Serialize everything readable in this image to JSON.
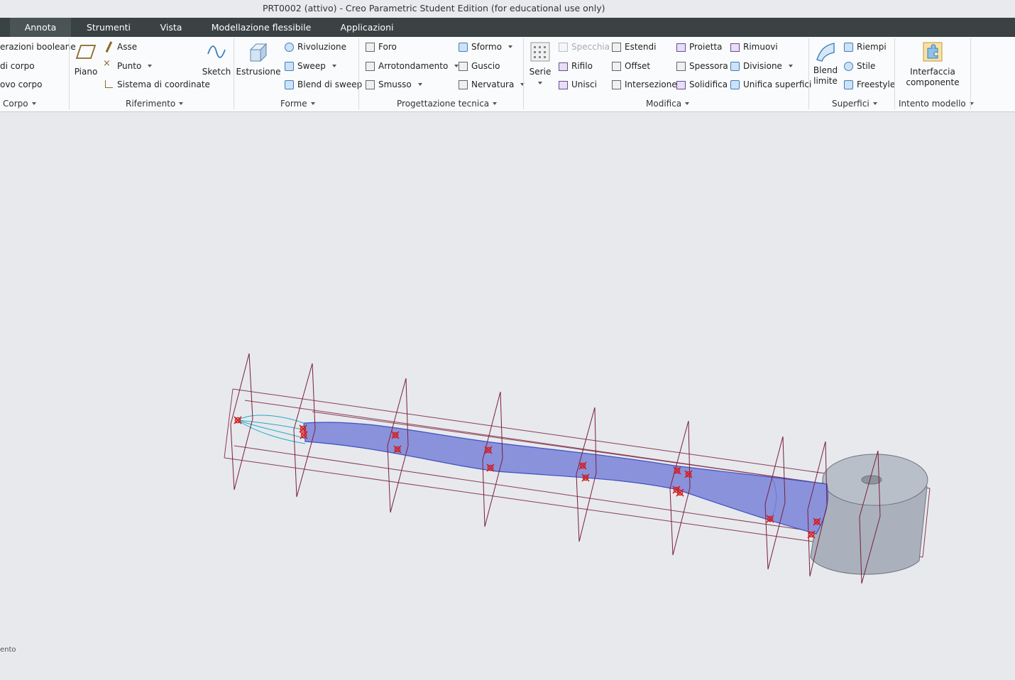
{
  "window": {
    "title": "PRT0002 (attivo) - Creo Parametric Student Edition (for educational use only)"
  },
  "tabs": [
    {
      "label": "Annota",
      "active": true
    },
    {
      "label": "Strumenti"
    },
    {
      "label": "Vista"
    },
    {
      "label": "Modellazione flessibile"
    },
    {
      "label": "Applicazioni"
    }
  ],
  "ribbon": {
    "corpo": {
      "items": [
        "erazioni booleane",
        "di corpo",
        "ovo corpo"
      ],
      "group": "Corpo"
    },
    "riferimento": {
      "piano": "Piano",
      "asse": "Asse",
      "punto": "Punto",
      "sistema": "Sistema di coordinate",
      "sketch": "Sketch",
      "group": "Riferimento"
    },
    "forme": {
      "estrusione": "Estrusione",
      "rivoluzione": "Rivoluzione",
      "sweep": "Sweep",
      "blend_sweep": "Blend di sweep",
      "group": "Forme"
    },
    "progettazione": {
      "foro": "Foro",
      "arrotondamento": "Arrotondamento",
      "smusso": "Smusso",
      "sformo": "Sformo",
      "guscio": "Guscio",
      "nervatura": "Nervatura",
      "group": "Progettazione tecnica"
    },
    "modifica": {
      "serie": "Serie",
      "specchia": "Specchia",
      "rifilo": "Rifilo",
      "unisci": "Unisci",
      "estendi": "Estendi",
      "offset": "Offset",
      "intersezione": "Intersezione",
      "proietta": "Proietta",
      "spessora": "Spessora",
      "solidifica": "Solidifica",
      "rimuovi": "Rimuovi",
      "divisione": "Divisione",
      "unifica": "Unifica superfici",
      "group": "Modifica"
    },
    "superfici": {
      "blend": [
        "Blend",
        "limite"
      ],
      "riempi": "Riempi",
      "stile": "Stile",
      "freestyle": "Freestyle",
      "group": "Superfici"
    },
    "intento": {
      "interfaccia": [
        "Interfaccia",
        "componente"
      ],
      "group": "Intento modello"
    }
  },
  "status": {
    "text": "ento"
  },
  "colors": {
    "sweep_fill": "#8a92dc",
    "datum_plane": "#7a1f3a",
    "curve": "#25a9c6",
    "point_marker": "#d11f1f",
    "body_gray": "#a7aeb8"
  }
}
